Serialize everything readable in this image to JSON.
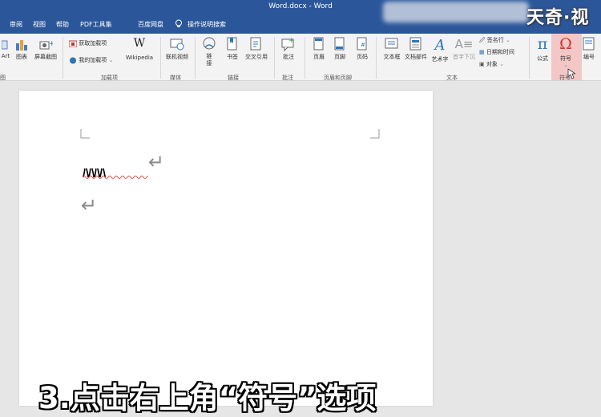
{
  "window": {
    "title": "Word.docx - Word"
  },
  "tabs": [
    "审阅",
    "视图",
    "帮助",
    "PDF工具集",
    "百度网盘"
  ],
  "tell_me": "操作说明搜索",
  "watermark": "天奇·视",
  "ribbon": {
    "buttons": {
      "smartart": "Art",
      "chart": "图表",
      "screenshot": "屏幕截图",
      "get_addins": "获取加载项",
      "my_addins": "我的加载项",
      "wikipedia": "Wikipedia",
      "online_video": "联机视频",
      "link": "链\n接",
      "bookmark": "书签",
      "cross_ref": "交叉引用",
      "comment": "批注",
      "header": "页眉",
      "footer": "页脚",
      "page_number": "页码",
      "textbox": "文本框",
      "quick_parts": "文档部件",
      "wordart": "艺术字",
      "drop_cap": "首字下沉",
      "signature_line": "签名行",
      "date_time": "日期和时间",
      "object": "对象",
      "equation": "公式",
      "symbol": "符号",
      "number": "编号"
    },
    "groups": {
      "illustrations_tail": "图",
      "addins": "加载项",
      "media": "媒体",
      "links": "链接",
      "comments": "批注",
      "header_footer": "页眉和页脚",
      "text": "文本",
      "symbols": "符号"
    }
  },
  "document": {
    "line1_text": "ﾊﾊﾊﾊ",
    "para_mark": "↵"
  },
  "caption": "3.点击右上角“符号”选项",
  "colors": {
    "title_bar": "#2b579a",
    "ribbon": "#f3f3f3",
    "highlight": "#f4c7c7",
    "symbol_red": "#c0392b"
  }
}
